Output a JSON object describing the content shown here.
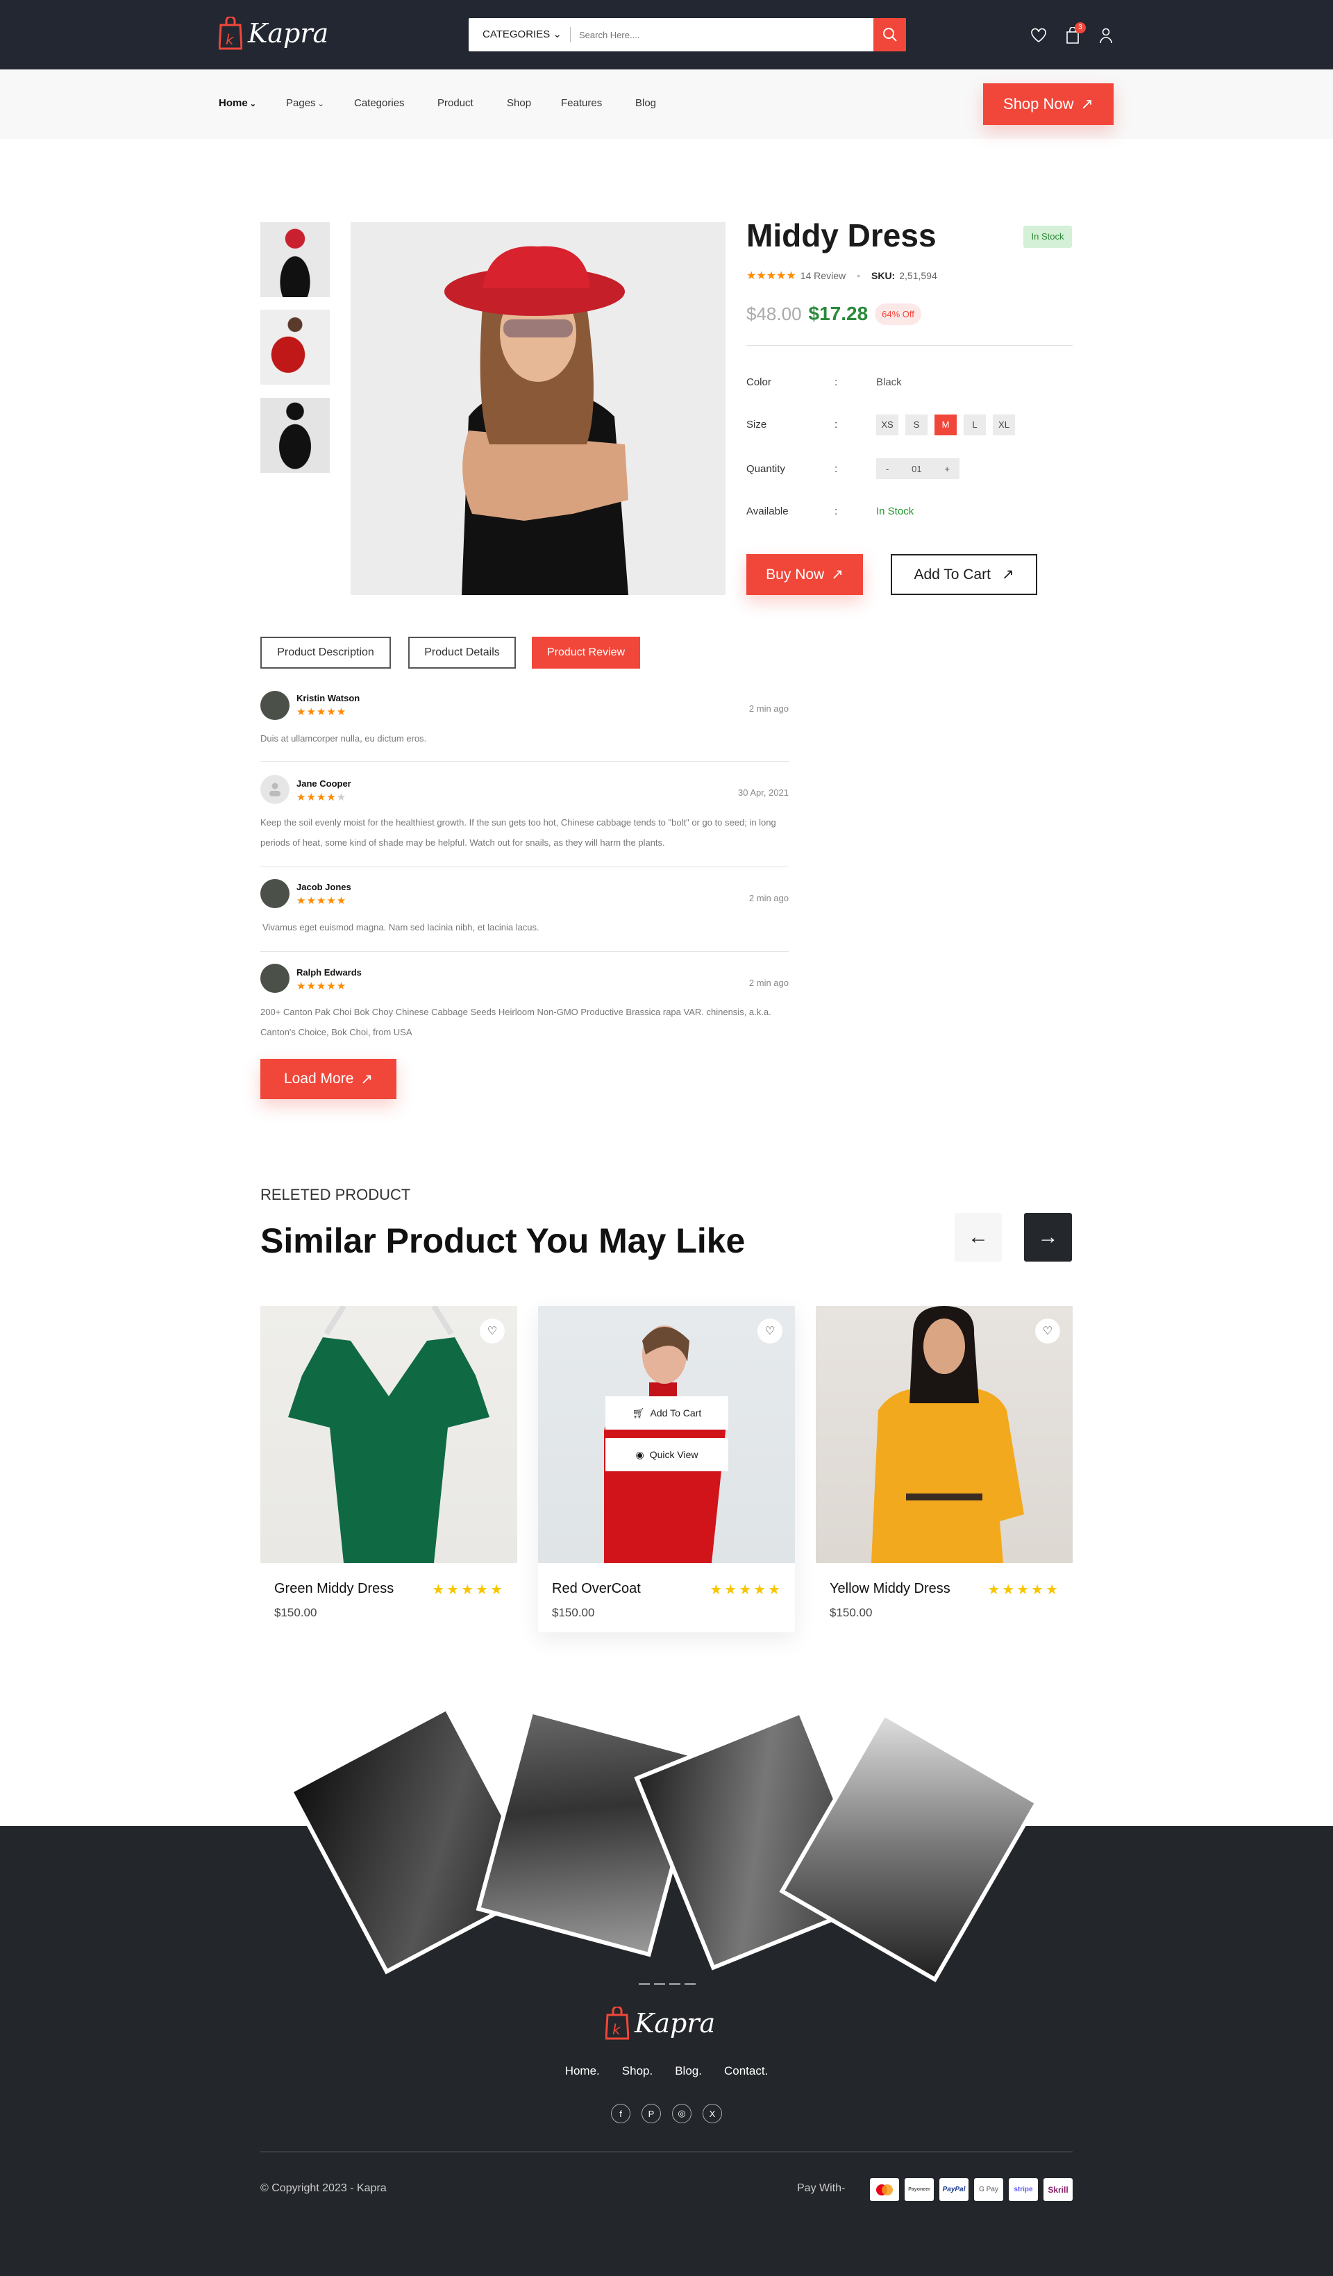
{
  "header": {
    "brand": "Kapra",
    "categories_label": "CATEGORIES",
    "search_placeholder": "Search Here....",
    "cart_count": "3"
  },
  "nav": {
    "items": [
      "Home",
      "Pages",
      "Categories",
      "Product",
      "Shop",
      "Features",
      "Blog"
    ],
    "shop_now": "Shop Now"
  },
  "product": {
    "title": "Middy Dress",
    "stock_badge": "In Stock",
    "rating": 5,
    "reviews": "14 Review",
    "sku_label": "SKU:",
    "sku": "2,51,594",
    "old_price": "$48.00",
    "price": "$17.28",
    "discount": "64% Off",
    "color_label": "Color",
    "color": "Black",
    "size_label": "Size",
    "sizes": [
      "XS",
      "S",
      "M",
      "L",
      "XL"
    ],
    "selected_size": "M",
    "quantity_label": "Quantity",
    "quantity": "01",
    "minus": "-",
    "plus": "+",
    "available_label": "Available",
    "available": "In Stock",
    "colon": ":",
    "buy_now": "Buy Now",
    "add_to_cart": "Add To Cart"
  },
  "tabs": [
    "Product Description",
    "Product Details",
    "Product Review"
  ],
  "active_tab": "Product Review",
  "reviews": [
    {
      "name": "Kristin Watson",
      "stars": "★★★★★",
      "rating": 5,
      "date": "2 min ago",
      "text": "Duis at ullamcorper nulla, eu dictum eros."
    },
    {
      "name": "Jane Cooper",
      "stars": "★★★★",
      "rating": 4,
      "date": "30 Apr, 2021",
      "text": "Keep the soil evenly moist for the healthiest growth. If the sun gets too hot, Chinese cabbage tends to \"bolt\" or go to seed; in long periods of heat, some kind of shade may be helpful. Watch out for snails, as they will harm the plants."
    },
    {
      "name": "Jacob Jones",
      "stars": "★★★★★",
      "rating": 5,
      "date": "2 min ago",
      "text": "Vivamus eget euismod magna. Nam sed lacinia nibh, et lacinia lacus."
    },
    {
      "name": "Ralph Edwards",
      "stars": "★★★★★",
      "rating": 5,
      "date": "2 min ago",
      "text": "200+ Canton Pak Choi Bok Choy Chinese Cabbage Seeds Heirloom Non-GMO Productive Brassica rapa VAR. chinensis, a.k.a. Canton's Choice, Bok Choi, from USA"
    }
  ],
  "load_more": "Load More",
  "related": {
    "eyebrow": "RELETED PRODUCT",
    "title": "Similar Product You May Like",
    "cards": [
      {
        "name": "Green Middy Dress",
        "price": "$150.00",
        "stars": "★★★★★"
      },
      {
        "name": "Red OverCoat",
        "price": "$150.00",
        "stars": "★★★★★"
      },
      {
        "name": "Yellow Middy Dress",
        "price": "$150.00",
        "stars": "★★★★★"
      }
    ],
    "hover_add_to_cart": "Add To Cart",
    "hover_quick_view": "Quick View"
  },
  "footer": {
    "brand": "Kapra",
    "links": [
      "Home.",
      "Shop.",
      "Blog.",
      "Contact."
    ],
    "social": [
      "facebook",
      "pinterest",
      "instagram",
      "x"
    ],
    "copyright": "© Copyright 2023 - Kapra",
    "pay_with": "Pay With-",
    "payments": [
      "mastercard",
      "Payoneer",
      "PayPal",
      "G Pay",
      "stripe",
      "Skrill"
    ]
  },
  "colors": {
    "accent": "#f1473a",
    "dark": "#222731",
    "green": "#2a8a3b"
  }
}
